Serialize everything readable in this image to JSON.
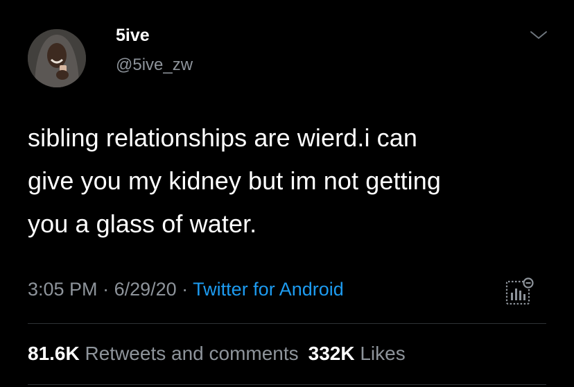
{
  "user": {
    "name": "5ive",
    "handle": "@5ive_zw"
  },
  "tweet": {
    "text_lines": [
      "sibling relationships are wierd.i can",
      "give you my kidney but im not getting",
      "you a glass of water."
    ]
  },
  "meta": {
    "time": "3:05 PM",
    "separator": " · ",
    "date": "6/29/20",
    "source": "Twitter for Android"
  },
  "stats": {
    "retweets_count": "81.6K",
    "retweets_label": "Retweets and comments",
    "likes_count": "332K",
    "likes_label": "Likes"
  },
  "icons": {
    "more": "chevron-down-icon",
    "analytics": "analytics-icon"
  },
  "colors": {
    "background": "#000000",
    "text": "#ffffff",
    "secondary": "#8e949b",
    "link": "#1d9bf0",
    "divider": "#2f3336"
  }
}
